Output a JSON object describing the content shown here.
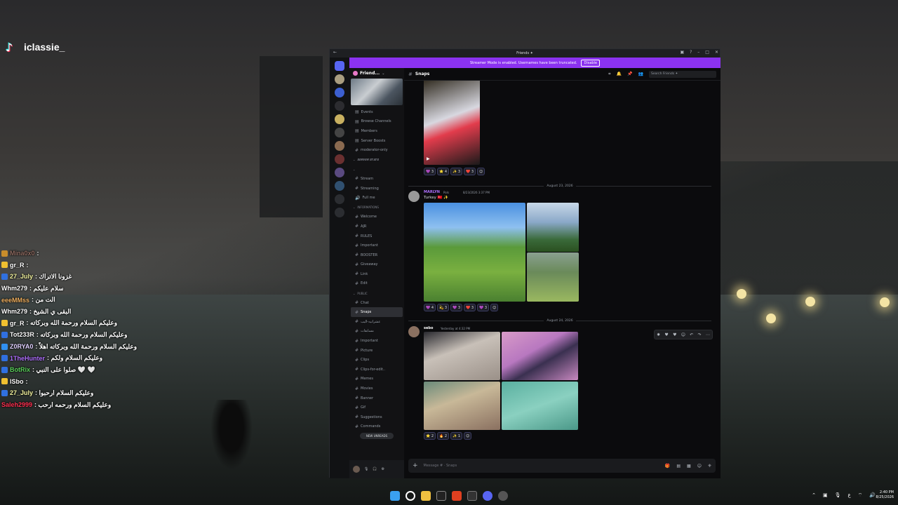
{
  "overlay": {
    "tiktok_handle": "iclassie_"
  },
  "chat": [
    {
      "name": "Mina0x0",
      "msg": ":  ",
      "color": "#8f6b61",
      "badge": "#c98d2b"
    },
    {
      "name": "gr_R",
      "msg": ":  ",
      "color": "#ffffff",
      "badge": "#f0c030"
    },
    {
      "name": "27_July",
      "msg": ": غزونا الاتراك",
      "color": "#f5f5a0",
      "badge": "#3070e0"
    },
    {
      "name": "Whm279",
      "msg": ": سلام عليكم",
      "color": "#ffffff",
      "badge": ""
    },
    {
      "name": "eeeMMss",
      "msg": ": الت من",
      "color": "#f0b060",
      "badge": ""
    },
    {
      "name": "Whm279",
      "msg": ": البقى ي الشيخ",
      "color": "#ffffff",
      "badge": ""
    },
    {
      "name": "gr_R",
      "msg": ": وعليكم السلام ورحمة الله وبركاته",
      "color": "#ffffff",
      "badge": "#f0c030"
    },
    {
      "name": "Tot233R",
      "msg": ": وعليكم السلام ورحمة الله وبركاته",
      "color": "#ffffff",
      "badge": "#3070e0"
    },
    {
      "name": "Z0RYA0",
      "msg": ": وعليكم السلام ورحمة الله وبركاته اهلاً",
      "color": "#e0d0ff",
      "badge": "#3090f0"
    },
    {
      "name": "1TheHunter",
      "msg": ": وعليكم السلام ولكم",
      "color": "#b070ff",
      "badge": "#3070e0"
    },
    {
      "name": "BotRix",
      "msg": ": صلوا على النبي 🤍 🤍",
      "color": "#5ad05a",
      "badge": "#3070e0"
    },
    {
      "name": "lSbo",
      "msg": ":  ",
      "color": "#ffffff",
      "badge": "#f0c030"
    },
    {
      "name": "27_July",
      "msg": ": وعليكم السلام ارحبوا",
      "color": "#f5f5a0",
      "badge": "#3070e0"
    },
    {
      "name": "Saleh2999",
      "msg": ": وعليكم السلام ورحمه ارحب",
      "color": "#ff3050",
      "badge": ""
    }
  ],
  "window": {
    "title": "Friends ✦",
    "banner_text": "Streamer Mode is enabled. Usernames have been truncated.",
    "banner_button": "Disable",
    "server_name": "Friend...",
    "channels": [
      {
        "label": "Events",
        "type": "item"
      },
      {
        "label": "Browse Channels",
        "type": "item"
      },
      {
        "label": "Members",
        "type": "item"
      },
      {
        "label": "Server Boosts",
        "type": "item"
      },
      {
        "label": "moderator-only",
        "type": "text"
      },
      {
        "label": "𝑺𝑬𝑹𝑽𝑬𝑹 𝑺𝑻𝑨𝑻𝑺",
        "type": "cat"
      },
      {
        "label": "",
        "type": "cat"
      },
      {
        "label": "Stream",
        "type": "text"
      },
      {
        "label": "Streaming",
        "type": "text"
      },
      {
        "label": "Full me",
        "type": "voice"
      },
      {
        "label": "INFORMATIONS",
        "type": "cat"
      },
      {
        "label": "Welcome",
        "type": "text"
      },
      {
        "label": "AJR",
        "type": "text"
      },
      {
        "label": "RULES",
        "type": "text"
      },
      {
        "label": "Important",
        "type": "text"
      },
      {
        "label": "BOOSTER",
        "type": "text"
      },
      {
        "label": "Giveaway",
        "type": "text"
      },
      {
        "label": "Link",
        "type": "text"
      },
      {
        "label": "Edit",
        "type": "text"
      },
      {
        "label": "PUBLIC",
        "type": "cat"
      },
      {
        "label": "Chat",
        "type": "text"
      },
      {
        "label": "Snaps",
        "type": "active"
      },
      {
        "label": "عشرانيه-اليب",
        "type": "text"
      },
      {
        "label": "مسابقات",
        "type": "text"
      },
      {
        "label": "Important",
        "type": "text"
      },
      {
        "label": "Picture",
        "type": "text"
      },
      {
        "label": "Clips",
        "type": "text"
      },
      {
        "label": "Clips-for-edit..",
        "type": "text"
      },
      {
        "label": "Memes",
        "type": "text"
      },
      {
        "label": "Movies",
        "type": "text"
      },
      {
        "label": "Banner",
        "type": "text"
      },
      {
        "label": "Gif",
        "type": "text"
      },
      {
        "label": "Suggestions",
        "type": "text"
      },
      {
        "label": "Commands",
        "type": "text"
      }
    ],
    "new_unreads": "NEW UNREADS",
    "channel_name": "Snaps",
    "search_placeholder": "Search Friends ✦",
    "composer_placeholder": "Message # · Snaps",
    "date1": "August 23, 2026",
    "date2": "August 24, 2026",
    "msg1": {
      "user": "MARLYN",
      "tag": "Pols",
      "time": "8/23/2026 3:37 PM",
      "text": "Turkey 🇹🇷 ✨"
    },
    "msg2": {
      "user": "sebo",
      "time": "Yesterday at 4:32 PM"
    },
    "reactions1": [
      "💜 3",
      "⭐ 4",
      "✨ 3",
      "❤️ 3"
    ],
    "reactions2": [
      "💜 4",
      "💫 3",
      "💜 3",
      "❤️ 3",
      "💜 3"
    ],
    "reactions3": [
      "⭐ 2",
      "🔥 2",
      "✨ 1"
    ]
  },
  "taskbar": {
    "lang": "ع",
    "time": "2:40 PM",
    "date": "8/25/2026"
  }
}
